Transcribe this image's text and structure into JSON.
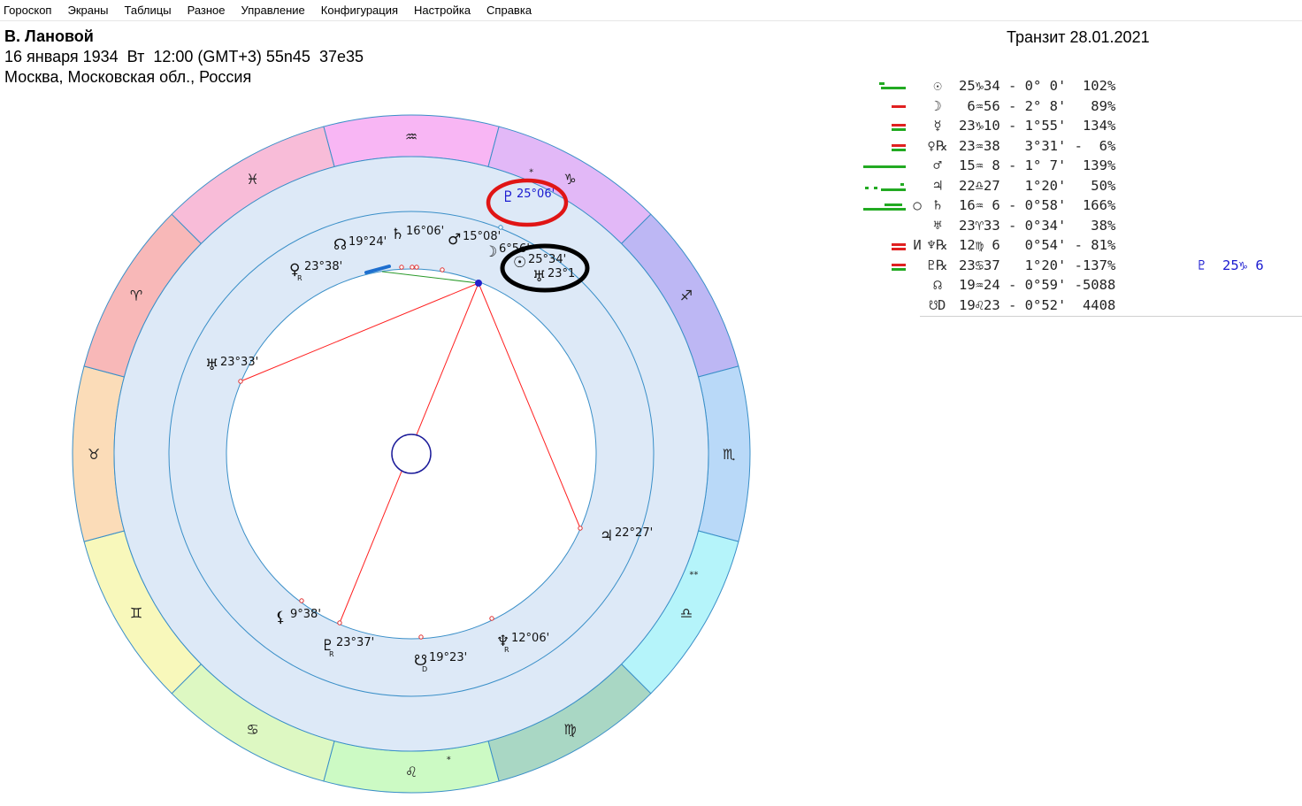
{
  "menu": [
    "Гороскоп",
    "Экраны",
    "Таблицы",
    "Разное",
    "Управление",
    "Конфигурация",
    "Настройка",
    "Справка"
  ],
  "header": {
    "name": "В. Лановой",
    "birth_info": "16 января 1934  Вт  12:00 (GMT+3) 55n45  37e35",
    "place": "Москва, Московская обл., Россия",
    "transit": "Транзит 28.01.2021"
  },
  "colors": {
    "accent_green": "#22aa22",
    "accent_red": "#e02020",
    "ring_line": "#3a8fc8",
    "aspect_red": "#ff2020",
    "highlight_blue": "#1a1ad0"
  },
  "table": [
    {
      "symbol": "☉",
      "mark": "",
      "pos": "25♑34 - 0° 0'  102%",
      "extra": "",
      "bars": [
        {
          "color": "green",
          "len": 28,
          "y": 0.55
        },
        {
          "color": "green",
          "len": 6,
          "y": 0.3,
          "x": 22
        }
      ]
    },
    {
      "symbol": "☽",
      "mark": "",
      "pos": " 6♒56 - 2° 8'   89%",
      "extra": "",
      "bars": [
        {
          "color": "red",
          "len": 16,
          "y": 0.45
        }
      ]
    },
    {
      "symbol": "☿",
      "mark": "",
      "pos": "23♑10 - 1°55'  134%",
      "extra": "",
      "bars": [
        {
          "color": "red",
          "len": 16,
          "y": 0.4
        },
        {
          "color": "green",
          "len": 16,
          "y": 0.62
        }
      ]
    },
    {
      "symbol": "♀℞",
      "mark": "",
      "pos": "23♒38   3°31' -  6%",
      "extra": "",
      "bars": [
        {
          "color": "red",
          "len": 16,
          "y": 0.4
        },
        {
          "color": "green",
          "len": 16,
          "y": 0.62
        }
      ]
    },
    {
      "symbol": "♂",
      "mark": "",
      "pos": "15♒ 8 - 1° 7'  139%",
      "extra": "",
      "bars": [
        {
          "color": "green",
          "len": 48,
          "y": 0.5
        }
      ]
    },
    {
      "symbol": "♃",
      "mark": "",
      "pos": "22♎27   1°20'   50%",
      "extra": "",
      "bars": [
        {
          "color": "green",
          "len": 4,
          "x": 6,
          "y": 0.55
        },
        {
          "color": "green",
          "len": 4,
          "x": 16,
          "y": 0.55
        },
        {
          "color": "green",
          "len": 28,
          "y": 0.6
        },
        {
          "color": "green",
          "len": 4,
          "x": 46,
          "y": 0.35
        }
      ]
    },
    {
      "symbol": "♄",
      "mark": "○",
      "pos": "16♒ 6 - 0°58'  166%",
      "extra": "",
      "bars": [
        {
          "color": "green",
          "len": 48,
          "y": 0.6
        },
        {
          "color": "green",
          "len": 20,
          "x": 28,
          "y": 0.4
        }
      ]
    },
    {
      "symbol": "♅",
      "mark": "",
      "pos": "23♈33 - 0°34'   38%",
      "extra": "",
      "bars": []
    },
    {
      "symbol": "♆℞",
      "mark": "И",
      "pos": "12♍ 6   0°54' - 81%",
      "extra": "",
      "bars": [
        {
          "color": "red",
          "len": 16,
          "y": 0.4
        },
        {
          "color": "red",
          "len": 16,
          "y": 0.62
        }
      ]
    },
    {
      "symbol": "♇℞",
      "mark": "",
      "pos": "23♋37   1°20' -137%",
      "extra": "♇  25♑ 6",
      "bars": [
        {
          "color": "red",
          "len": 16,
          "y": 0.4
        },
        {
          "color": "green",
          "len": 16,
          "y": 0.62
        }
      ]
    },
    {
      "symbol": "☊",
      "mark": "",
      "pos": "19♒24 - 0°59' -5088",
      "extra": "",
      "bars": []
    },
    {
      "symbol": "☋D",
      "mark": "",
      "pos": "19♌23 - 0°52'  4408",
      "extra": "",
      "bars": []
    }
  ],
  "zodiac": [
    {
      "glyph": "♒",
      "color": "#f8b6f4",
      "star": ""
    },
    {
      "glyph": "♑",
      "color": "#e2b8f7",
      "star": "*"
    },
    {
      "glyph": "♐",
      "color": "#bdb7f4",
      "star": ""
    },
    {
      "glyph": "♏",
      "color": "#b9d9f8",
      "star": ""
    },
    {
      "glyph": "♎",
      "color": "#b5f4fa",
      "star": "**"
    },
    {
      "glyph": "♍",
      "color": "#a9d7c4",
      "star": ""
    },
    {
      "glyph": "♌",
      "color": "#ccfac4",
      "star": "*"
    },
    {
      "glyph": "♋",
      "color": "#ddf8c2",
      "star": ""
    },
    {
      "glyph": "♊",
      "color": "#f8f8bb",
      "star": ""
    },
    {
      "glyph": "♉",
      "color": "#fbdcb8",
      "star": ""
    },
    {
      "glyph": "♈",
      "color": "#f8b8b8",
      "star": ""
    },
    {
      "glyph": "♓",
      "color": "#f8bcd8",
      "star": ""
    }
  ],
  "natal_planets": [
    {
      "id": "pluto-transit",
      "sym": "♇",
      "deg": "25°06'",
      "highlight": "red",
      "transit": true
    },
    {
      "id": "sun",
      "sym": "☉",
      "deg": "25°34'",
      "highlight": "black"
    },
    {
      "id": "uranus",
      "sym": "♅",
      "deg": "23°1",
      "highlight": "black"
    },
    {
      "id": "moon",
      "sym": "☽",
      "deg": "6°56'"
    },
    {
      "id": "mars",
      "sym": "♂",
      "deg": "15°08'"
    },
    {
      "id": "saturn",
      "sym": "♄",
      "deg": "16°06'"
    },
    {
      "id": "node",
      "sym": "☊",
      "deg": "19°24'"
    },
    {
      "id": "venus",
      "sym": "♀",
      "deg": "23°38'",
      "sub": "R"
    },
    {
      "id": "uranus2",
      "sym": "♅",
      "deg": "23°33'"
    },
    {
      "id": "jupiter",
      "sym": "♃",
      "deg": "22°27'"
    },
    {
      "id": "neptune",
      "sym": "♆",
      "deg": "12°06'",
      "sub": "R"
    },
    {
      "id": "snode",
      "sym": "☋",
      "deg": "19°23'",
      "sub": "D"
    },
    {
      "id": "pluto",
      "sym": "♇",
      "deg": "23°37'",
      "sub": "R"
    },
    {
      "id": "lilith",
      "sym": "⚸",
      "deg": "9°38'"
    }
  ]
}
